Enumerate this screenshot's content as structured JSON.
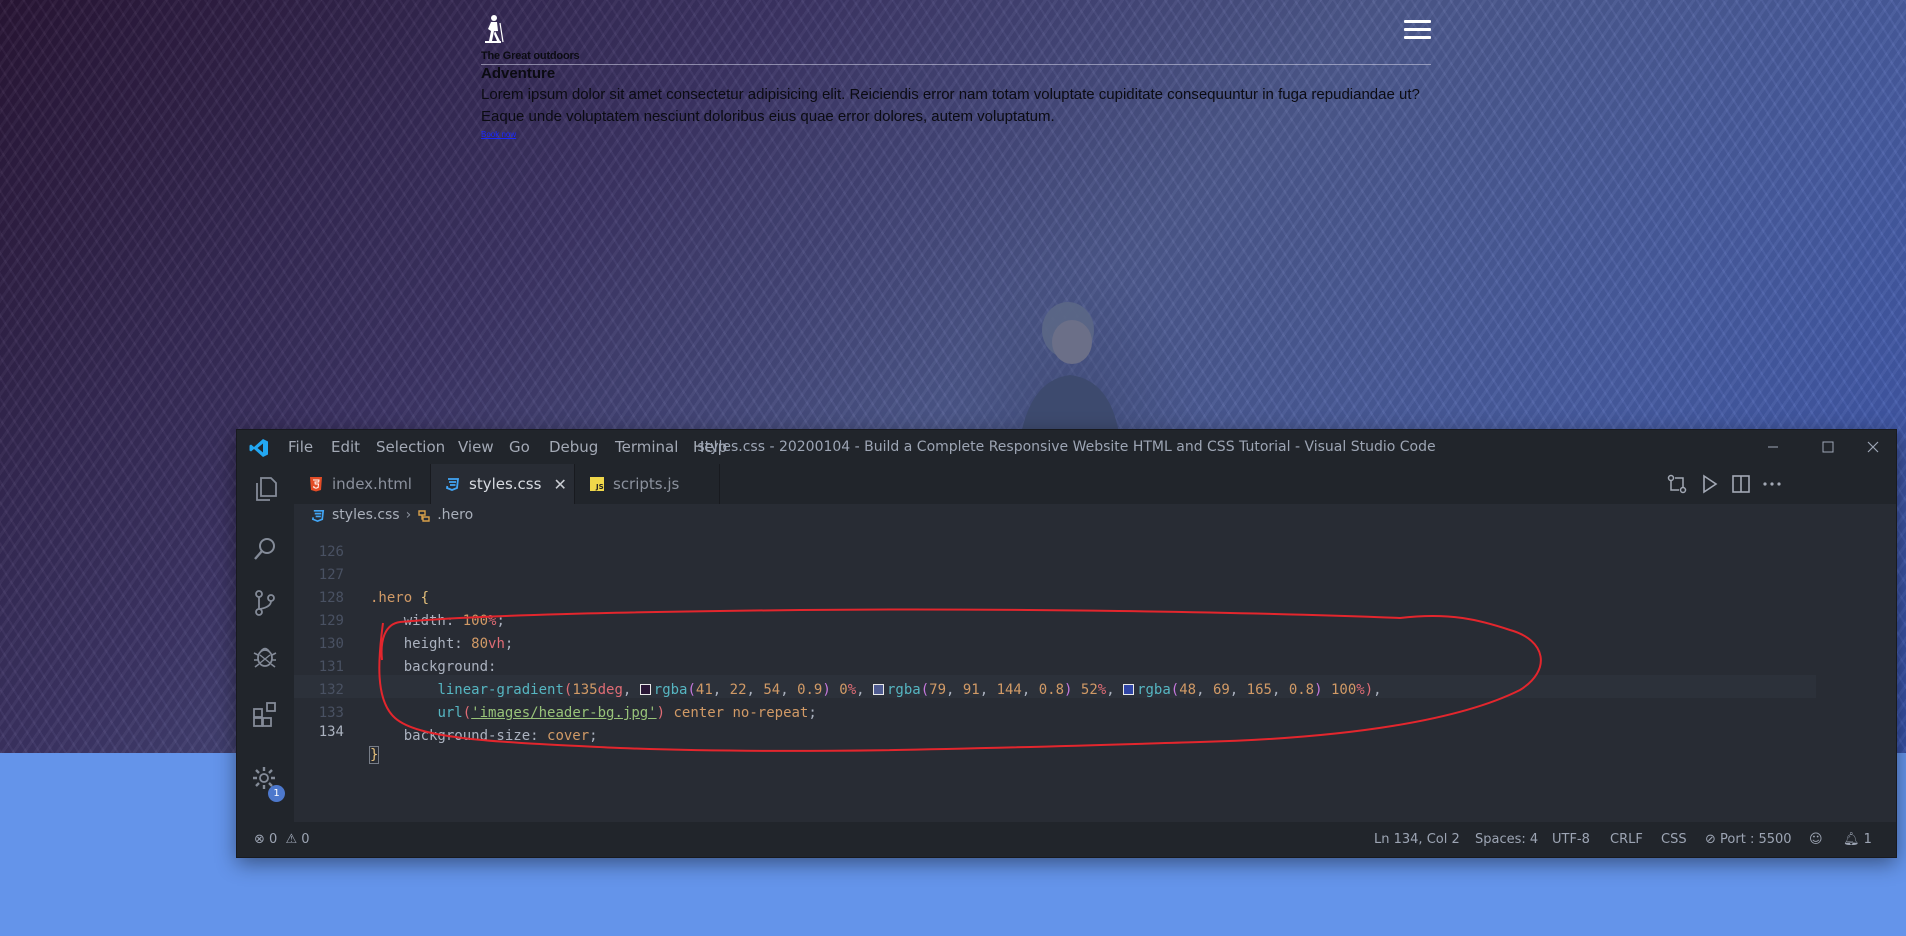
{
  "website": {
    "logo_text": "The Great outdoors",
    "hero_title": "Adventure",
    "hero_paragraph": "Lorem ipsum dolor sit amet consectetur adipisicing elit. Reiciendis error nam totam voluptate cupiditate consequuntur in fuga repudiandae ut? Eaque unde voluptatem nesciunt doloribus eius quae error dolores, autem voluptatum.",
    "cta_link": "Book now"
  },
  "vscode": {
    "menu": [
      "File",
      "Edit",
      "Selection",
      "View",
      "Go",
      "Debug",
      "Terminal",
      "Help"
    ],
    "window_title": "styles.css - 20200104 - Build a Complete Responsive Website HTML and CSS Tutorial - Visual Studio Code",
    "tabs": [
      {
        "label": "index.html",
        "icon": "html5-icon"
      },
      {
        "label": "styles.css",
        "icon": "css3-icon",
        "active": true
      },
      {
        "label": "scripts.js",
        "icon": "js-icon"
      }
    ],
    "breadcrumb": {
      "file": "styles.css",
      "symbol": ".hero"
    },
    "code": {
      "line_numbers": [
        "126",
        "127",
        "128",
        "129",
        "130",
        "131",
        "132",
        "133",
        "134"
      ],
      "l127_selector": ".hero",
      "l127_brace": "{",
      "l128_prop": "width",
      "l128_num": "100",
      "l128_unit": "%",
      "l129_prop": "height",
      "l129_num": "80",
      "l129_unit": "vh",
      "l130_prop": "background",
      "l131_fn": "linear-gradient",
      "l131_angle": "135",
      "l131_angle_unit": "deg",
      "color_stops": [
        {
          "fn": "rgba",
          "args": [
            "41",
            "22",
            "54",
            "0.9"
          ],
          "pos": "0",
          "swatch": "#291636"
        },
        {
          "fn": "rgba",
          "args": [
            "79",
            "91",
            "144",
            "0.8"
          ],
          "pos": "52",
          "swatch": "#4f5b90"
        },
        {
          "fn": "rgba",
          "args": [
            "48",
            "69",
            "165",
            "0.8"
          ],
          "pos": "100",
          "swatch": "#3045a5"
        }
      ],
      "l132_fn": "url",
      "l132_str": "'images/header-bg.jpg'",
      "l132_kw1": "center",
      "l132_kw2": "no-repeat",
      "l133_prop": "background-size",
      "l133_val": "cover",
      "l134_brace": "}"
    },
    "status": {
      "errors": "0",
      "warnings": "0",
      "position": "Ln 134, Col 2",
      "spaces": "Spaces: 4",
      "encoding": "UTF-8",
      "eol": "CRLF",
      "language": "CSS",
      "port": "Port : 5500",
      "notifications": "1"
    },
    "settings_badge": "1"
  },
  "colors": {
    "accent_badge": "#4d78cc",
    "annotation": "#e3262d",
    "page_blue": "#6494ea"
  }
}
